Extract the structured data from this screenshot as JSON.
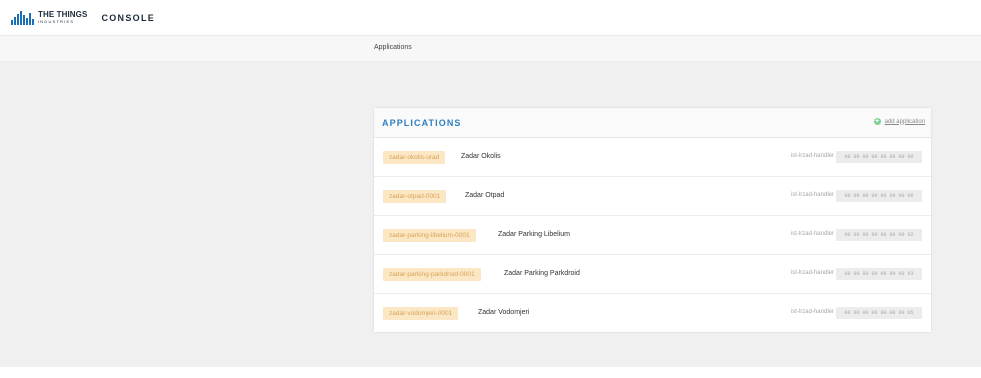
{
  "header": {
    "logo_line1": "THE THINGS",
    "logo_line2": "INDUSTRIES",
    "console_label": "CONSOLE"
  },
  "breadcrumb": {
    "current": "Applications"
  },
  "applications_panel": {
    "title": "APPLICATIONS",
    "add_label": "add application",
    "items": [
      {
        "id": "zadar-okolis-urad",
        "name": "Zadar Okolis",
        "handler": "ist-lrzad-handler",
        "eui": "00 00 00 00 00 00 00 00"
      },
      {
        "id": "zadar-otpad-0001",
        "name": "Zadar Otpad",
        "handler": "ist-lrzad-handler",
        "eui": "00 00 00 00 00 00 00 06"
      },
      {
        "id": "zadar-parking-libelium-0001",
        "name": "Zadar Parking Libelium",
        "handler": "ist-lrzad-handler",
        "eui": "00 00 00 00 00 00 00 02"
      },
      {
        "id": "zadar-parking-parkdroid-0001",
        "name": "Zadar Parking Parkdroid",
        "handler": "ist-lrzad-handler",
        "eui": "00 00 00 00 00 00 00 03"
      },
      {
        "id": "zadar-vodomjeri-0001",
        "name": "Zadar Vodomjeri",
        "handler": "ist-lrzad-handler",
        "eui": "00 00 00 00 00 00 00 05"
      }
    ]
  },
  "colors": {
    "accent": "#2d7fc1",
    "tag_bg": "#fbe7c4",
    "tag_text": "#d9a257",
    "add_icon": "#7fcf8f"
  },
  "icons": {
    "logo": "ttn-bars-logo",
    "add": "plus-circle-icon"
  }
}
